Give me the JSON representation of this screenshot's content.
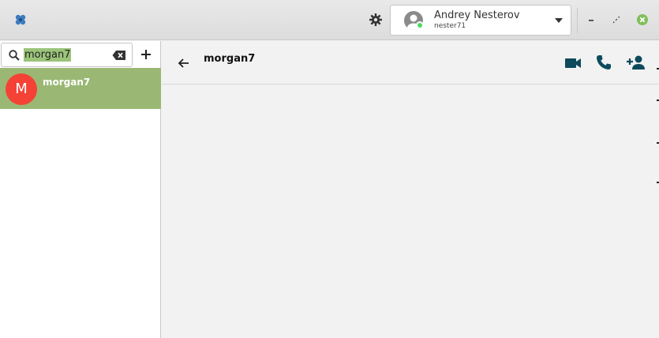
{
  "account": {
    "display_name": "Andrey Nesterov",
    "username": "nester71"
  },
  "search": {
    "query": "morgan7"
  },
  "contacts": [
    {
      "initial": "M",
      "name": "morgan7"
    }
  ],
  "conversation": {
    "title": "morgan7"
  },
  "icons": {
    "app_logo": "app-logo-icon",
    "settings": "gear-icon",
    "search": "search-icon",
    "clear": "backspace-icon",
    "add": "plus-icon",
    "back": "arrow-left-icon",
    "video": "video-call-icon",
    "call": "phone-icon",
    "add_contact": "person-add-icon"
  },
  "colors": {
    "selected_row": "#9ab874",
    "avatar_red": "#f44336",
    "icon_teal": "#0d4a5c",
    "presence_green": "#4cd964",
    "close_green": "#7fbf5a"
  }
}
